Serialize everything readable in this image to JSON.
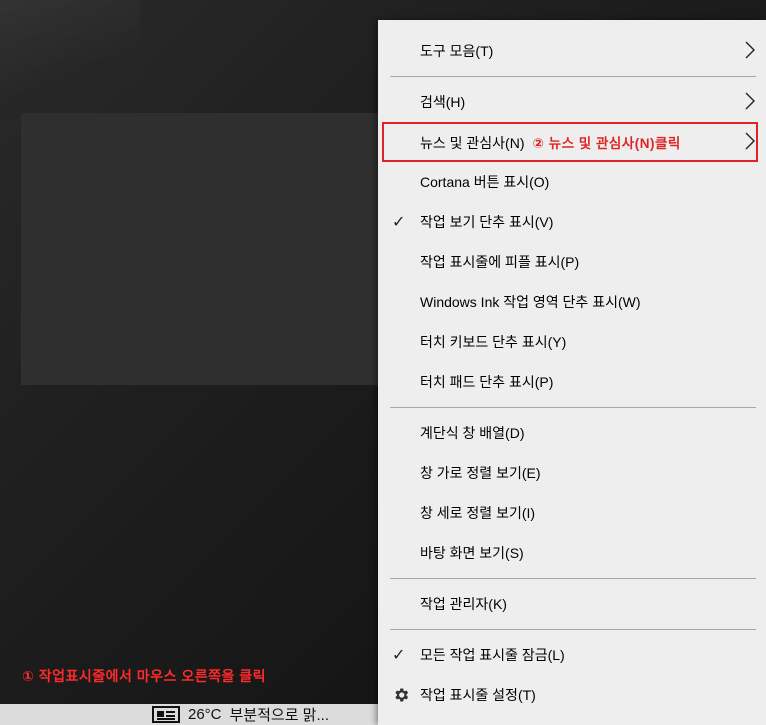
{
  "menu": {
    "items": [
      {
        "id": "toolbars",
        "label": "도구 모음(T)",
        "submenu": true,
        "checked": false
      },
      {
        "id": "search",
        "label": "검색(H)",
        "submenu": true,
        "checked": false
      },
      {
        "id": "news",
        "label": "뉴스 및 관심사(N)",
        "submenu": true,
        "checked": false
      },
      {
        "id": "cortana",
        "label": "Cortana 버튼 표시(O)",
        "submenu": false,
        "checked": false
      },
      {
        "id": "taskview",
        "label": "작업 보기 단추 표시(V)",
        "submenu": false,
        "checked": true
      },
      {
        "id": "people",
        "label": "작업 표시줄에 피플 표시(P)",
        "submenu": false,
        "checked": false
      },
      {
        "id": "ink",
        "label": "Windows Ink 작업 영역 단추 표시(W)",
        "submenu": false,
        "checked": false
      },
      {
        "id": "touchkb",
        "label": "터치 키보드 단추 표시(Y)",
        "submenu": false,
        "checked": false
      },
      {
        "id": "touchpad",
        "label": "터치 패드 단추 표시(P)",
        "submenu": false,
        "checked": false
      },
      {
        "id": "cascade",
        "label": "계단식 창 배열(D)",
        "submenu": false,
        "checked": false
      },
      {
        "id": "stacked",
        "label": "창 가로 정렬 보기(E)",
        "submenu": false,
        "checked": false
      },
      {
        "id": "sidebyside",
        "label": "창 세로 정렬 보기(I)",
        "submenu": false,
        "checked": false
      },
      {
        "id": "desktop",
        "label": "바탕 화면 보기(S)",
        "submenu": false,
        "checked": false
      },
      {
        "id": "taskmgr",
        "label": "작업 관리자(K)",
        "submenu": false,
        "checked": false
      },
      {
        "id": "lock",
        "label": "모든 작업 표시줄 잠금(L)",
        "submenu": false,
        "checked": true
      },
      {
        "id": "settings",
        "label": "작업 표시줄 설정(T)",
        "submenu": false,
        "checked": false,
        "icon": "gear-icon"
      }
    ]
  },
  "annotations": {
    "step1": "① 작업표시줄에서 마우스 오른쪽을 클릭",
    "step2": "② 뉴스 및 관심사(N)클릭",
    "color": "#e02424"
  },
  "taskbar": {
    "news_widget": {
      "temperature": "26°C",
      "condition": "부분적으로 맑...",
      "icon": "news-icon"
    }
  },
  "check_glyph": "✓"
}
